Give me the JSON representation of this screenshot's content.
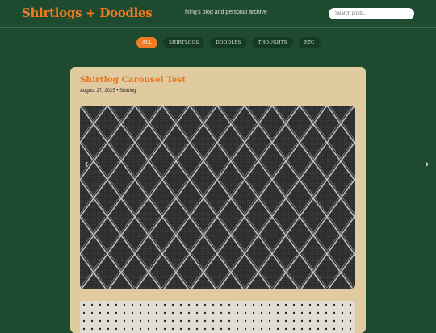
{
  "header": {
    "site_title": "Shirtlogs + Doodles",
    "tagline": "fking's blog and personal archive",
    "search_placeholder": "Search posts..."
  },
  "filters": [
    {
      "label": "ALL",
      "active": true
    },
    {
      "label": "SHIRTLOGS",
      "active": false
    },
    {
      "label": "DOODLES",
      "active": false
    },
    {
      "label": "THOUGHTS",
      "active": false
    },
    {
      "label": "ETC",
      "active": false
    }
  ],
  "post": {
    "title": "Shirtlog Carousel Test",
    "meta": "August 27, 2025 • Shirtlog"
  },
  "carousel": {
    "prev_glyph": "‹",
    "next_glyph": "›"
  },
  "colors": {
    "background": "#1e4a30",
    "accent": "#f07b22",
    "card": "#dfcb9f",
    "pill": "#143a24"
  }
}
